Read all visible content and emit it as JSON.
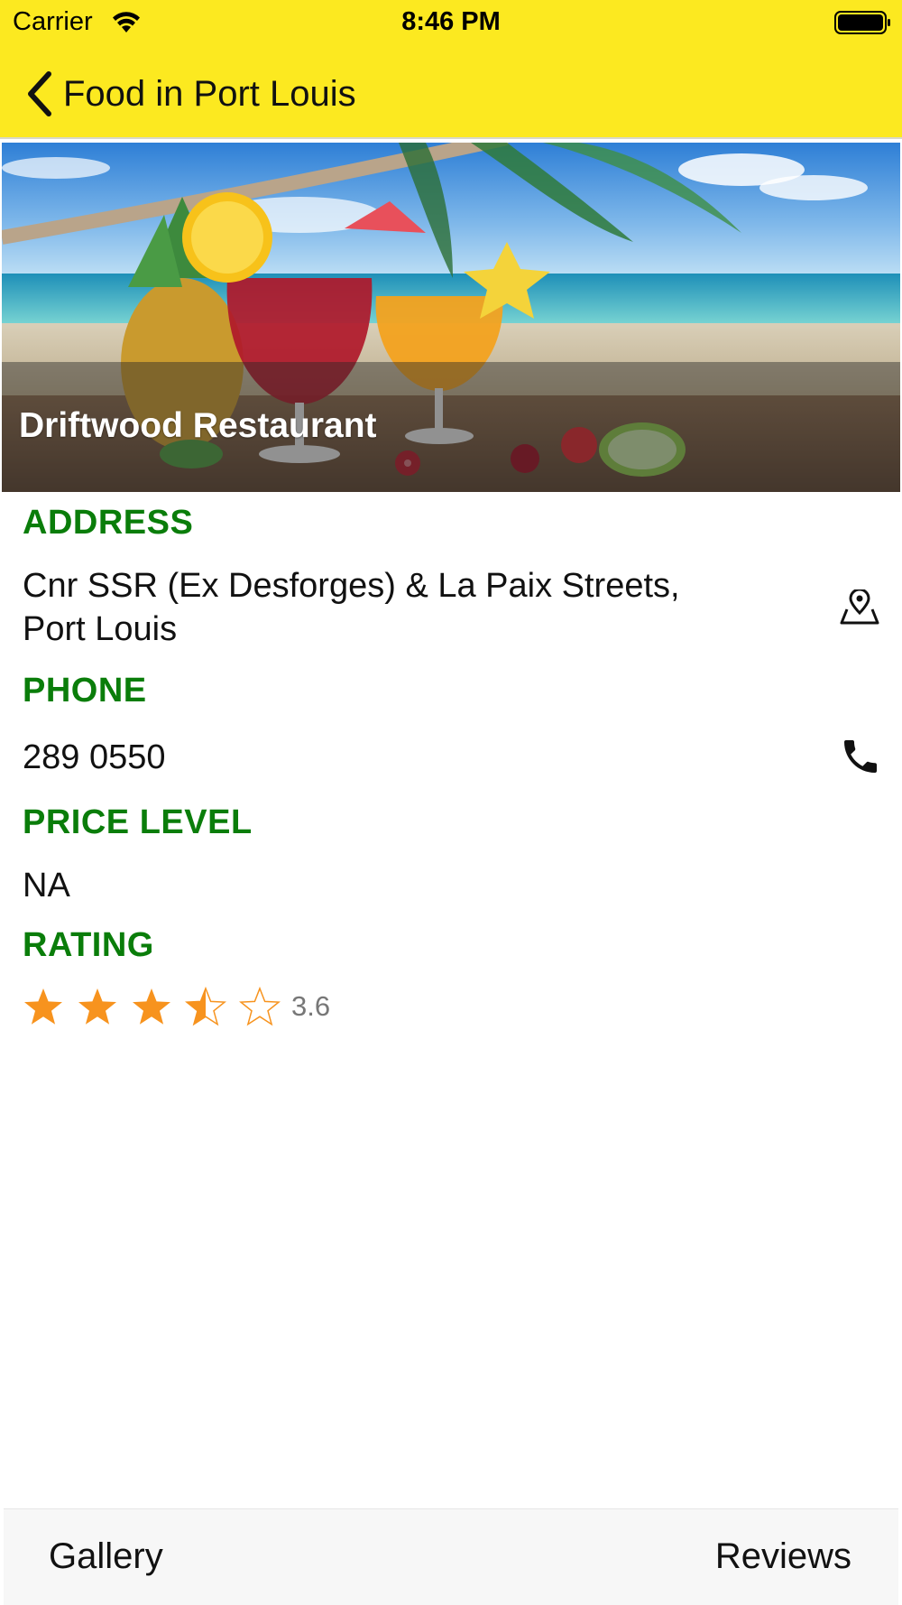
{
  "status_bar": {
    "carrier": "Carrier",
    "time": "8:46 PM"
  },
  "nav": {
    "back_title": "Food in Port Louis"
  },
  "restaurant": {
    "name": "Driftwood Restaurant",
    "address_label": "ADDRESS",
    "address_line1": "Cnr SSR (Ex Desforges) & La Paix Streets,",
    "address_line2": "Port Louis",
    "phone_label": "PHONE",
    "phone": "289 0550",
    "price_label": "PRICE LEVEL",
    "price_level": "NA",
    "rating_label": "RATING",
    "rating": 3.6,
    "rating_text": "3.6",
    "rating_max": 5
  },
  "toolbar": {
    "gallery_label": "Gallery",
    "reviews_label": "Reviews"
  },
  "colors": {
    "bar": "#FCE920",
    "section_label": "#0A7D0A",
    "star": "#F7931E"
  },
  "icons": {
    "map": "map-pin-icon",
    "phone": "phone-icon"
  }
}
